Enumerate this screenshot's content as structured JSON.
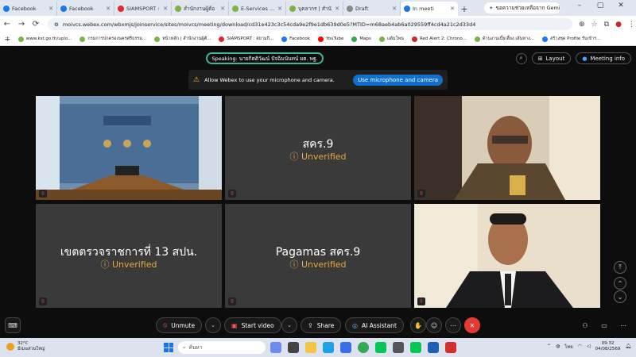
{
  "browser": {
    "tabs": [
      {
        "label": "Facebook",
        "color": "#1877f2",
        "active": false
      },
      {
        "label": "Facebook",
        "color": "#1877f2",
        "active": false
      },
      {
        "label": "SIAMSPORT :",
        "color": "#e3262b",
        "active": false
      },
      {
        "label": "สำนักงานผู้ต้อ",
        "color": "#7cb342",
        "active": false
      },
      {
        "label": "E-Services | ก",
        "color": "#7cb342",
        "active": false
      },
      {
        "label": "บุคลากร | สำนั",
        "color": "#7cb342",
        "active": false
      },
      {
        "label": "Draft",
        "color": "#888888",
        "active": false
      },
      {
        "label": "In meeti",
        "color": "#1a73e8",
        "active": true
      }
    ],
    "new_tab": "+",
    "gemini_label": "ขอความช่วยเหลือจาก Gemini",
    "window_controls": [
      "–",
      "▢",
      "✕"
    ],
    "url": "moivcs.webex.com/wbxmjs/joinservice/sites/moivcs/meeting/download/cd31e423c3c54cda9e2f9e1db639d0e5?MTID=m68aeb4ab6a029559ff4cd4a21c2d33d4",
    "bookmarks": [
      {
        "label": "www.kst.go.th/uplo...",
        "color": "#7cb342"
      },
      {
        "label": "กรมการปกครองนครศรีธรรม...",
        "color": "#7cb342"
      },
      {
        "label": "หน้าหลัก | สำนักงานผู้ตั...",
        "color": "#7cb342"
      },
      {
        "label": "SIAMSPORT : สยามกี...",
        "color": "#e3262b"
      },
      {
        "label": "Facebook",
        "color": "#1877f2"
      },
      {
        "label": "YouTube",
        "color": "#ff0000"
      },
      {
        "label": "Maps",
        "color": "#34a853"
      },
      {
        "label": "แต้มโพน",
        "color": "#7cb342"
      },
      {
        "label": "Red Alert 2: Chrono...",
        "color": "#c62828"
      },
      {
        "label": "ด้านงานเบี้ยเลี้ยง เส้นทาง...",
        "color": "#7cb342"
      },
      {
        "label": "สร้างชุด Profile รับเข้าร...",
        "color": "#1877f2"
      }
    ]
  },
  "meeting": {
    "speaking": "Speaking: นายกิตติวัฒน์ ปัจฉิมนันทน์ ผต. พฐ.",
    "layout_label": "Layout",
    "meeting_info_label": "Meeting info",
    "permission_text": "Allow Webex to use your microphone and camera.",
    "permission_button": "Use microphone and camera",
    "tiles": [
      {
        "kind": "video",
        "scene": "room"
      },
      {
        "kind": "name",
        "title": "สคร.9",
        "status": "Unverified"
      },
      {
        "kind": "video",
        "scene": "officer"
      },
      {
        "kind": "name",
        "title": "เขตตรวจราชการที่ 13 สปน.",
        "status": "Unverified"
      },
      {
        "kind": "name",
        "title": "Pagamas สคร.9",
        "status": "Unverified"
      },
      {
        "kind": "video",
        "scene": "man"
      }
    ],
    "toolbar": {
      "unmute": "Unmute",
      "start_video": "Start video",
      "share": "Share",
      "ai_assistant": "AI Assistant"
    }
  },
  "taskbar": {
    "weather_temp": "32°C",
    "weather_desc": "มีเมฆส่วนใหญ่",
    "search_placeholder": "ค้นหา",
    "lang": "ไทย",
    "time": "09:32",
    "date": "04/08/2569"
  },
  "colors": {
    "accent": "#1170cf",
    "speaking_border": "#3fb89a",
    "unverified": "#e8a93a",
    "end_call": "#e53935"
  }
}
